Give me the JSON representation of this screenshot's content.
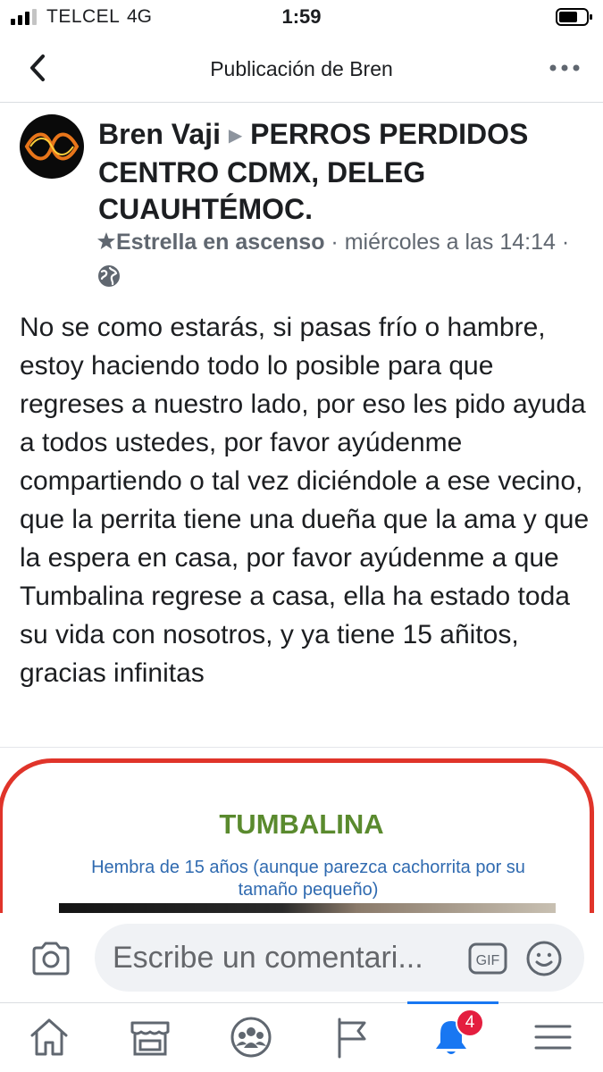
{
  "status_bar": {
    "carrier": "TELCEL",
    "network": "4G",
    "time": "1:59"
  },
  "nav": {
    "title": "Publicación de Bren",
    "back_icon": "chevron-left-icon",
    "more_icon": "more-horizontal-icon"
  },
  "post": {
    "author": "Bren Vaji",
    "group": "PERROS PERDIDOS CENTRO CDMX, DELEG CUAUHTÉMOC.",
    "badge": "Estrella en ascenso",
    "date": "miércoles a las 14:14",
    "separator": "·",
    "body": "No se como estarás, si pasas frío o hambre, estoy haciendo todo lo posible para que regreses a nuestro lado, por eso les pido ayuda a todos ustedes, por favor ayúdenme compartiendo o tal vez diciéndole a ese vecino, que la perrita tiene una dueña que la ama y que la espera en casa, por favor ayúdenme a que Tumbalina regrese a casa, ella ha estado toda su vida con nosotros, y ya tiene 15 añitos, gracias infinitas",
    "attachment": {
      "title": "TUMBALINA",
      "subtitle": "Hembra de 15 años (aunque parezca cachorrita por su tamaño pequeño)",
      "frame_color": "#e0342a",
      "title_color": "#5a8a2e",
      "subtitle_color": "#2f6ab0"
    }
  },
  "comment_bar": {
    "placeholder": "Escribe un comentari...",
    "gif_label": "GIF"
  },
  "tabs": [
    {
      "name": "home",
      "icon": "home-icon"
    },
    {
      "name": "marketplace",
      "icon": "marketplace-icon"
    },
    {
      "name": "groups",
      "icon": "groups-icon"
    },
    {
      "name": "pages",
      "icon": "flag-icon"
    },
    {
      "name": "notifications",
      "icon": "bell-icon",
      "active": true,
      "badge": "4"
    },
    {
      "name": "menu",
      "icon": "menu-icon"
    }
  ],
  "colors": {
    "accent": "#1877f2",
    "badge": "#e41e3f",
    "text": "#1c1e21",
    "meta": "#606770"
  }
}
